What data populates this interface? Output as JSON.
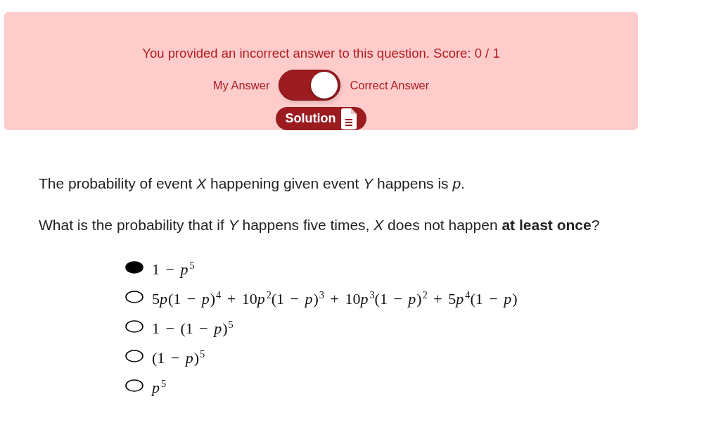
{
  "feedback": {
    "message": "You provided an incorrect answer to this question. Score: 0 / 1",
    "toggle": {
      "left_label": "My Answer",
      "right_label": "Correct Answer",
      "on": true
    },
    "solution_button": "Solution"
  },
  "question": {
    "paragraphs": [
      "The probability of event *X* happening given event *Y* happens is *p*.",
      "What is the probability that if *Y* happens five times, *X* does not happen **at least once**?"
    ]
  },
  "options": [
    {
      "text": "1 − p$^{5}$",
      "selected": true
    },
    {
      "text": "5p(1 − p)$^{4}$ + 10p$^{2}$(1 − p)$^{3}$ + 10p$^{3}$(1 − p)$^{2}$ + 5p$^{4}$(1 − p)",
      "selected": false
    },
    {
      "text": "1 − (1 − p)$^{5}$",
      "selected": false
    },
    {
      "text": "(1 − p)$^{5}$",
      "selected": false
    },
    {
      "text": "p$^{5}$",
      "selected": false
    }
  ]
}
